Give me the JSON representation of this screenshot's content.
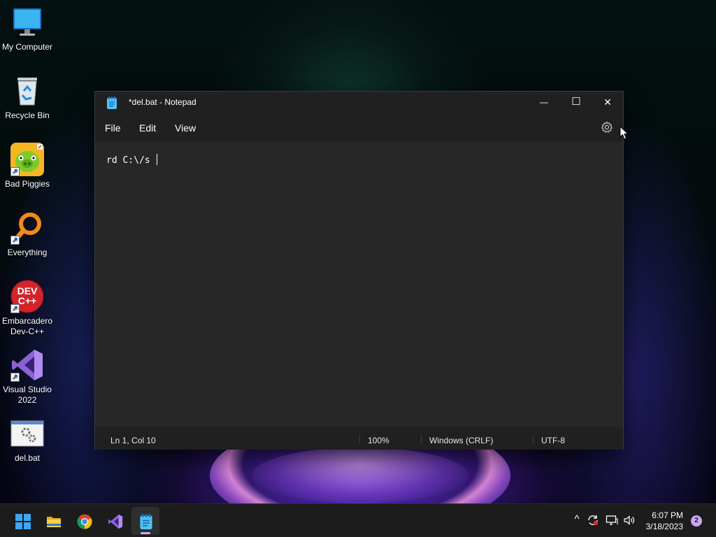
{
  "desktop": {
    "icons": [
      {
        "label": "My Computer"
      },
      {
        "label": "Recycle Bin"
      },
      {
        "label": "Bad Piggies"
      },
      {
        "label": "Everything"
      },
      {
        "label": "Embarcadero Dev-C++",
        "line1": "Embarcadero",
        "line2": "Dev-C++",
        "badge": "DEV C++"
      },
      {
        "label": "Visual Studio 2022",
        "line1": "Visual Studio",
        "line2": "2022"
      },
      {
        "label": "del.bat"
      }
    ]
  },
  "notepad": {
    "title": "*del.bat - Notepad",
    "window_controls": {
      "minimize": "—",
      "maximize": "☐",
      "close": "✕"
    },
    "menu": {
      "file": "File",
      "edit": "Edit",
      "view": "View"
    },
    "content": "rd C:\\/s ",
    "status": {
      "position": "Ln 1, Col 10",
      "zoom": "100%",
      "line_ending": "Windows (CRLF)",
      "encoding": "UTF-8"
    }
  },
  "taskbar": {
    "pinned": [
      "start-icon",
      "file-explorer-icon",
      "chrome-icon",
      "visual-studio-icon",
      "notepad-icon"
    ],
    "active": "notepad-icon",
    "tray": {
      "chevron": "^",
      "time": "6:07 PM",
      "date": "3/18/2023",
      "notification_count": "2"
    }
  },
  "colors": {
    "accent": "#d9a6f5",
    "window_bg": "#272727",
    "titlebar_bg": "#202020",
    "taskbar_bg": "#1c1c1c"
  }
}
